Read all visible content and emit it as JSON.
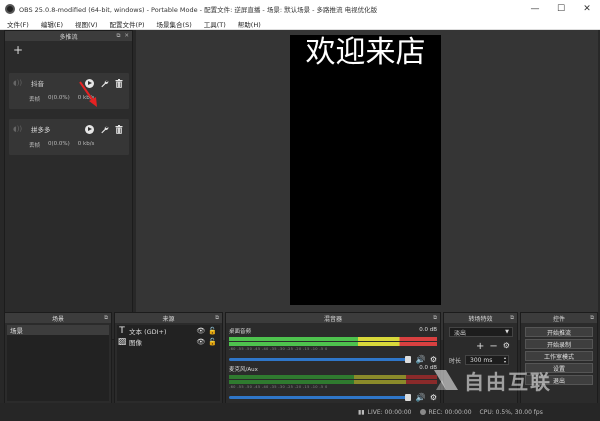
{
  "window": {
    "title": "OBS 25.0.8-modified (64-bit, windows) - Portable Mode - 配置文件: 逆屏直播 - 场景: 默认场景 - 多路推流 电视优化版",
    "minimize": "—",
    "maximize": "☐",
    "close": "✕"
  },
  "menu": [
    "文件(F)",
    "编辑(E)",
    "视图(V)",
    "配置文件(P)",
    "场景集合(S)",
    "工具(T)",
    "帮助(H)"
  ],
  "multistream": {
    "title": "多推流",
    "add_label": "+",
    "targets": [
      {
        "name": "抖音",
        "drop_label": "丢帧",
        "drop_value": "0(0.0%)",
        "rate": "0 kb/s"
      },
      {
        "name": "拼多多",
        "drop_label": "丢帧",
        "drop_value": "0(0.0%)",
        "rate": "0 kb/s"
      }
    ]
  },
  "preview": {
    "text": "欢迎来店"
  },
  "scenes": {
    "title": "场景",
    "items": [
      "场景"
    ]
  },
  "sources": {
    "title": "来源",
    "items": [
      {
        "name": "文本 (GDI+)",
        "icon": "text-icon"
      },
      {
        "name": "图像",
        "icon": "image-icon"
      }
    ]
  },
  "mixer": {
    "title": "混音器",
    "channels": [
      {
        "name": "桌面音频",
        "db": "0.0 dB"
      },
      {
        "name": "麦克风/Aux",
        "db": "0.0 dB"
      }
    ],
    "ticks": "-60 -55 -50 -45 -40 -35 -30 -25 -20 -15 -10 -5 0"
  },
  "transitions": {
    "title": "转场特效",
    "selected": "淡出",
    "duration_label": "时长",
    "duration_value": "300 ms"
  },
  "controls": {
    "title": "控件",
    "buttons": [
      "开始推流",
      "开始录制",
      "工作室模式",
      "设置",
      "退出"
    ]
  },
  "status": {
    "live": "LIVE: 00:00:00",
    "rec": "REC: 00:00:00",
    "cpu": "CPU: 0.5%, 30.00 fps"
  },
  "watermark": {
    "text": "自由互联"
  },
  "colors": {
    "accent": "#2f76c8",
    "arrow": "#e52222",
    "meter_green": "#4ec24e"
  }
}
